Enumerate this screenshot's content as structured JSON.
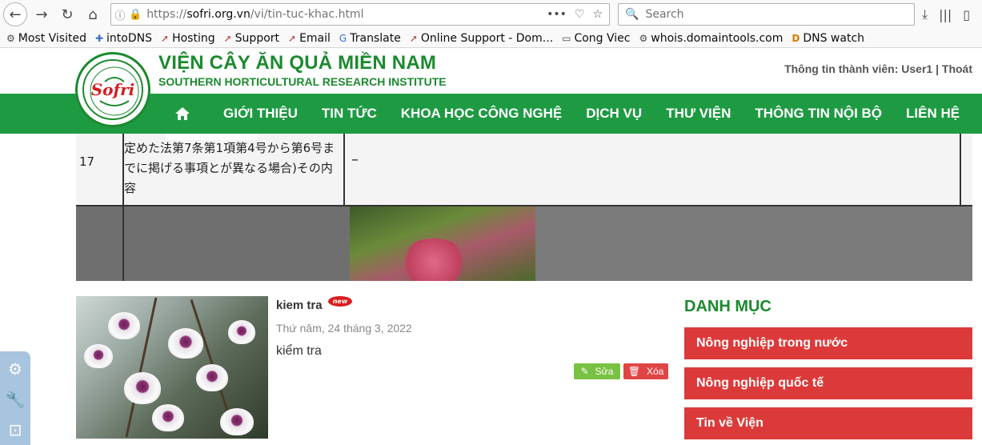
{
  "browser": {
    "url_protocol": "https://",
    "url_domain": "sofri.org.vn",
    "url_path": "/vi/tin-tuc-khac.html",
    "search_placeholder": "Search",
    "bookmarks": [
      {
        "label": "Most Visited",
        "icon": "gear-icon"
      },
      {
        "label": "intoDNS",
        "icon": "puzzle-icon"
      },
      {
        "label": "Hosting",
        "icon": "pa-icon"
      },
      {
        "label": "Support",
        "icon": "pa-icon"
      },
      {
        "label": "Email",
        "icon": "pa-icon"
      },
      {
        "label": "Translate",
        "icon": "translate-icon"
      },
      {
        "label": "Online Support - Dom...",
        "icon": "pa-icon"
      },
      {
        "label": "Cong Viec",
        "icon": "folder-icon"
      },
      {
        "label": "whois.domaintools.com",
        "icon": "gear-icon"
      },
      {
        "label": "DNS watch",
        "icon": "d-icon"
      }
    ]
  },
  "site": {
    "title": "VIỆN CÂY ĂN QUẢ MIỀN NAM",
    "subtitle": "SOUTHERN HORTICULTURAL RESEARCH INSTITUTE",
    "logo_text": "Sofri",
    "member_label": "Thông tin thành viên:",
    "member_name": "User1",
    "logout": "Thoát"
  },
  "menu": [
    "GIỚI THIỆU",
    "TIN TỨC",
    "KHOA HỌC CÔNG NGHỆ",
    "DỊCH VỤ",
    "THƯ VIỆN",
    "THÔNG TIN NỘI BỘ",
    "LIÊN HỆ"
  ],
  "banner": {
    "row_number": "17",
    "lines": [
      "定めた法第7条第1項第4号から第6号ま",
      "でに掲げる事項とが異なる場合)その内",
      "容"
    ],
    "dash": "–"
  },
  "news": {
    "title": "kiem tra",
    "badge": "new",
    "date": "Thứ năm, 24 tháng 3, 2022",
    "description": "kiểm tra",
    "edit_label": "Sửa",
    "delete_label": "Xóa"
  },
  "sidebar": {
    "title": "DANH MỤC",
    "items": [
      "Nông nghiệp trong nước",
      "Nông nghiệp quốc tế",
      "Tin về Viện"
    ]
  },
  "colors": {
    "brand_green": "#1e9a43",
    "category_red": "#dc3a3a"
  }
}
